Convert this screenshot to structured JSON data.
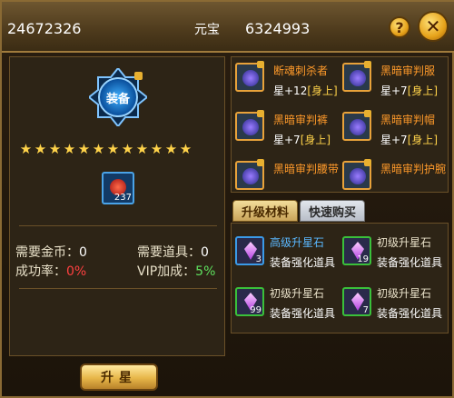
{
  "header": {
    "gold": "24672326",
    "yuanbao_label": "元宝",
    "yuanbao": "6324993",
    "help_label": "?",
    "close_label": "✕"
  },
  "left": {
    "emblem_text": "装备",
    "star_count": 12,
    "item_count": "237",
    "gold_needed_label": "需要金币：",
    "gold_needed_value": "0",
    "items_needed_label": "需要道具：",
    "items_needed_value": "0",
    "success_label": "成功率：",
    "success_value": "0%",
    "vip_label": "VIP加成：",
    "vip_value": "5%"
  },
  "equipment": [
    {
      "name": "断魂刺杀者",
      "star": "星+12",
      "status": "[身上]"
    },
    {
      "name": "黑暗审判服",
      "star": "星+7",
      "status": "[身上]"
    },
    {
      "name": "黑暗审判裤",
      "star": "星+7",
      "status": "[身上]"
    },
    {
      "name": "黑暗审判帽",
      "star": "星+7",
      "status": "[身上]"
    },
    {
      "name": "黑暗审判腰带",
      "star": "",
      "status": ""
    },
    {
      "name": "黑暗审判护腕",
      "star": "",
      "status": ""
    }
  ],
  "tabs": {
    "materials": "升级材料",
    "quick_buy": "快速购买"
  },
  "materials": [
    {
      "name": "高级升星石",
      "desc": "装备强化道具",
      "qty": "3",
      "tier": "blue"
    },
    {
      "name": "初级升星石",
      "desc": "装备强化道具",
      "qty": "19",
      "tier": "green"
    },
    {
      "name": "初级升星石",
      "desc": "装备强化道具",
      "qty": "99",
      "tier": "green"
    },
    {
      "name": "初级升星石",
      "desc": "装备强化道具",
      "qty": "7",
      "tier": "green"
    }
  ],
  "upgrade_button": "升星"
}
